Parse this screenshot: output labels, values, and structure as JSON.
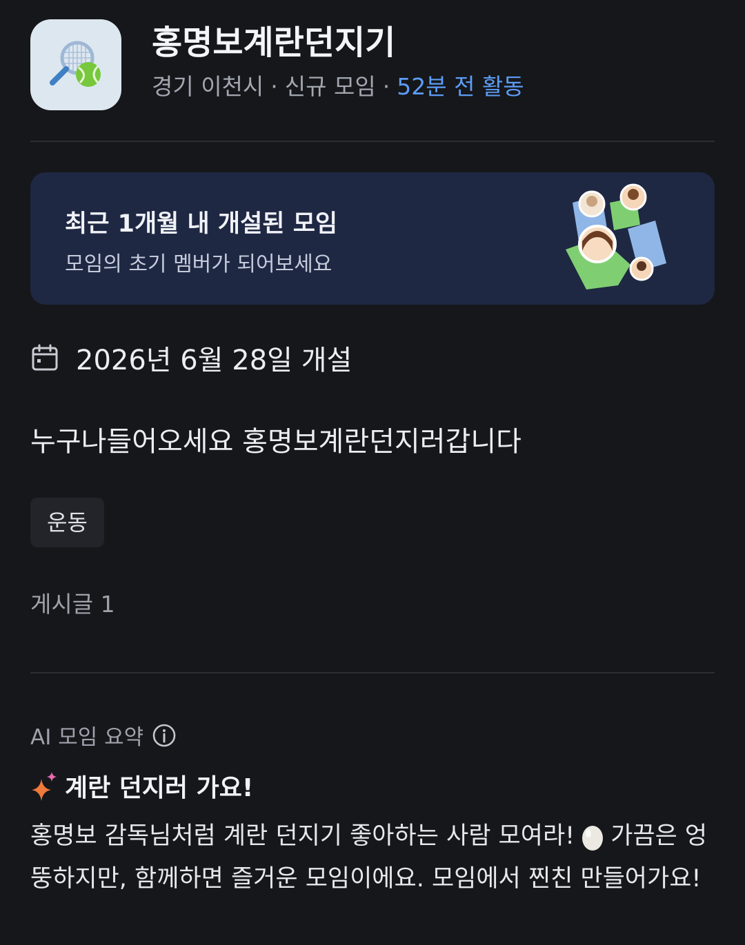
{
  "header": {
    "title": "홍명보계란던지기",
    "region": "경기 이천시",
    "separator": "·",
    "status": "신규 모임",
    "activity": "52분 전 활동",
    "accent_color": "#5c9df5"
  },
  "banner": {
    "title": "최근 1개월 내 개설된 모임",
    "subtitle": "모임의 초기 멤버가 되어보세요"
  },
  "details": {
    "created_date": "2026년 6월 28일 개설",
    "description": "누구나들어오세요 홍명보계란던지러갑니다",
    "tag": "운동",
    "posts": "게시글 1"
  },
  "ai_summary": {
    "label": "AI 모임 요약",
    "heading": "계란 던지러 가요!",
    "body_part1": "홍명보 감독님처럼 계란 던지기 좋아하는 사람 모여라!",
    "body_part2": "가끔은 엉뚱하지만, 함께하면 즐거운 모임이에요. 모임에서 찐친 만들어가요!"
  },
  "icons": {
    "app": "tennis-racket-ball-icon",
    "calendar": "calendar-icon",
    "info": "info-icon",
    "sparkle": "sparkle-icon",
    "egg": "egg-icon"
  }
}
